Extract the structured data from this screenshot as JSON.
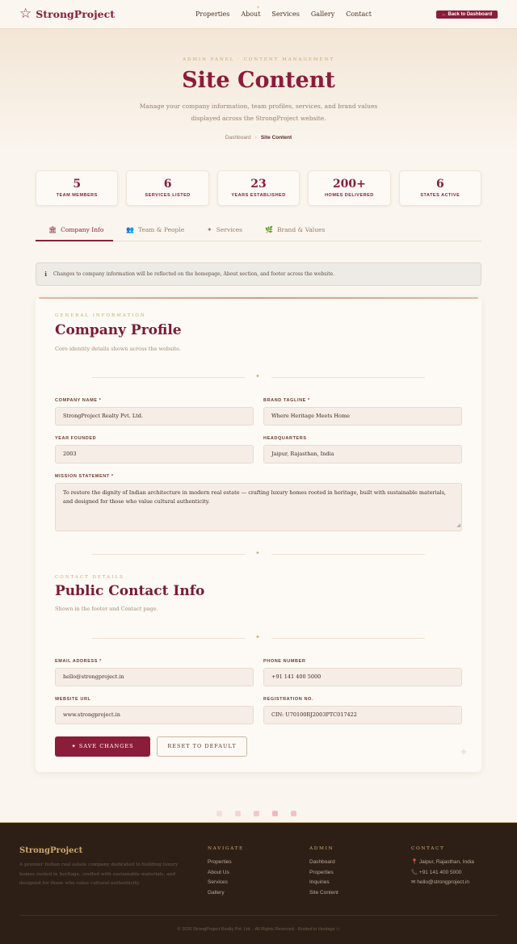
{
  "nav": {
    "brand": "StrongProject",
    "links": [
      "Properties",
      "About",
      "Services",
      "Gallery",
      "Contact"
    ],
    "back_button": "← Back to Dashboard"
  },
  "hero": {
    "eyebrow": "ADMIN PANEL · CONTENT MANAGEMENT",
    "title": "Site Content",
    "description": "Manage your company information, team profiles, services, and brand values displayed across the StrongProject website.",
    "breadcrumb": {
      "home": "Dashboard",
      "separator": "›",
      "current": "Site Content"
    }
  },
  "stats": [
    {
      "value": "5",
      "label": "TEAM MEMBERS"
    },
    {
      "value": "6",
      "label": "SERVICES LISTED"
    },
    {
      "value": "23",
      "label": "YEARS ESTABLISHED"
    },
    {
      "value": "200+",
      "label": "HOMES DELIVERED"
    },
    {
      "value": "6",
      "label": "STATES ACTIVE"
    }
  ],
  "tabs": [
    {
      "icon": "🏛",
      "label": "Company Info",
      "active": true
    },
    {
      "icon": "👥",
      "label": "Team & People",
      "active": false
    },
    {
      "icon": "✦",
      "label": "Services",
      "active": false
    },
    {
      "icon": "🌿",
      "label": "Brand & Values",
      "active": false
    }
  ],
  "notice": {
    "icon": "ℹ",
    "text": "Changes to company information will be reflected on the homepage, About section, and footer across the website."
  },
  "general": {
    "eyebrow": "GENERAL INFORMATION",
    "title": "Company Profile",
    "subtitle": "Core identity details shown across the website.",
    "fields": {
      "company_name": {
        "label": "COMPANY NAME *",
        "value": "StrongProject Realty Pvt. Ltd."
      },
      "brand_tagline": {
        "label": "BRAND TAGLINE *",
        "value": "Where Heritage Meets Home"
      },
      "year_founded": {
        "label": "YEAR FOUNDED",
        "value": "2003"
      },
      "headquarters": {
        "label": "HEADQUARTERS",
        "value": "Jaipur, Rajasthan, India"
      },
      "mission": {
        "label": "MISSION STATEMENT *",
        "value": "To restore the dignity of Indian architecture in modern real estate — crafting luxury homes rooted in heritage, built with sustainable materials, and designed for those who value cultural authenticity."
      }
    }
  },
  "contact": {
    "eyebrow": "CONTACT DETAILS",
    "title": "Public Contact Info",
    "subtitle": "Shown in the footer and Contact page.",
    "fields": {
      "email": {
        "label": "EMAIL ADDRESS *",
        "value": "hello@strongproject.in"
      },
      "phone": {
        "label": "PHONE NUMBER",
        "value": "+91 141 400 5000"
      },
      "website": {
        "label": "WEBSITE URL",
        "value": "www.strongproject.in"
      },
      "registration": {
        "label": "REGISTRATION NO.",
        "value": "CIN: U70100RJ2003PTC017422"
      }
    }
  },
  "actions": {
    "save": "✦ SAVE CHANGES",
    "reset": "RESET TO DEFAULT"
  },
  "colors": {
    "accent": "#8b1c3a",
    "gold": "#c9a96e",
    "footer_bg": "#2e1f16"
  },
  "dots": [
    "#f3dede",
    "#f4d4d4",
    "#f5c6cb",
    "#f3b7c1",
    "#f2c0c7"
  ],
  "footer": {
    "brand": "StrongProject",
    "description": "A premier Indian real estate company dedicated to building luxury homes rooted in heritage, crafted with sustainable materials, and designed for those who value cultural authenticity.",
    "navigate": {
      "heading": "NAVIGATE",
      "items": [
        "Properties",
        "About Us",
        "Services",
        "Gallery"
      ]
    },
    "admin": {
      "heading": "ADMIN",
      "items": [
        "Dashboard",
        "Properties",
        "Inquiries",
        "Site Content"
      ]
    },
    "contact": {
      "heading": "CONTACT",
      "items": [
        "📍 Jaipur, Rajasthan, India",
        "📞 +91 141 400 5000",
        "✉ hello@strongproject.in"
      ]
    },
    "copyright": "© 2026 StrongProject Realty Pvt. Ltd. · All Rights Reserved · Rooted in Heritage ◇"
  }
}
